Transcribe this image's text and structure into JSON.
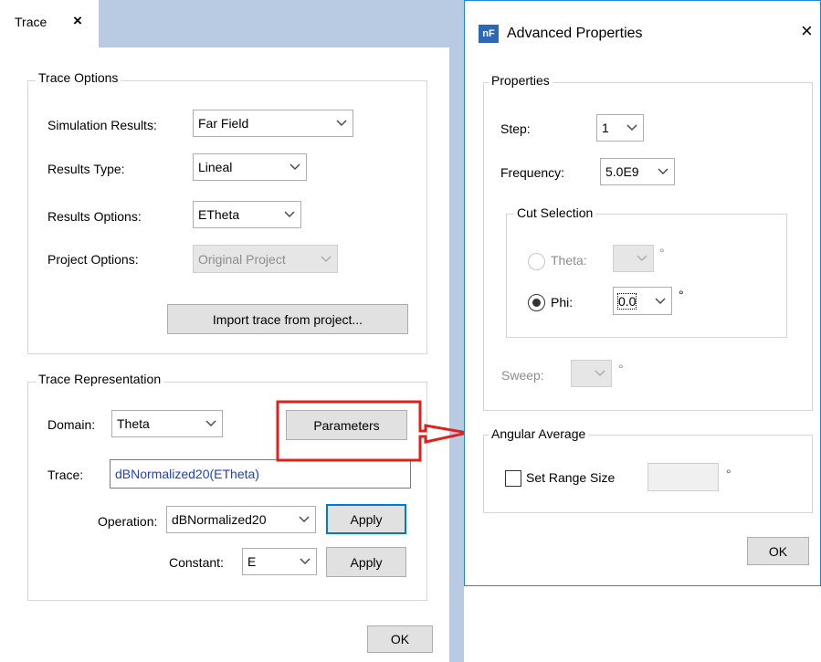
{
  "left": {
    "tab_label": "Trace",
    "tab_close": "×",
    "trace_options": {
      "legend": "Trace Options",
      "simulation_results_label": "Simulation Results:",
      "simulation_results_value": "Far Field",
      "results_type_label": "Results Type:",
      "results_type_value": "Lineal",
      "results_options_label": "Results Options:",
      "results_options_value": "ETheta",
      "project_options_label": "Project Options:",
      "project_options_value": "Original Project",
      "import_button": "Import trace from project..."
    },
    "trace_representation": {
      "legend": "Trace Representation",
      "domain_label": "Domain:",
      "domain_value": "Theta",
      "parameters_button": "Parameters",
      "trace_label": "Trace:",
      "trace_value": "dBNormalized20(ETheta)",
      "operation_label": "Operation:",
      "operation_value": "dBNormalized20",
      "operation_apply": "Apply",
      "constant_label": "Constant:",
      "constant_value": "E",
      "constant_apply": "Apply"
    },
    "ok_button": "OK"
  },
  "dialog": {
    "icon_text": "nF",
    "title": "Advanced Properties",
    "close": "×",
    "properties": {
      "legend": "Properties",
      "step_label": "Step:",
      "step_value": "1",
      "frequency_label": "Frequency:",
      "frequency_value": "5.0E9",
      "cut_selection": {
        "legend": "Cut Selection",
        "theta_label": "Theta:",
        "theta_value": "",
        "theta_unit": "°",
        "phi_label": "Phi:",
        "phi_value": "0.0",
        "phi_unit": "°"
      },
      "sweep_label": "Sweep:",
      "sweep_value": "",
      "sweep_unit": "°"
    },
    "angular_average": {
      "legend": "Angular Average",
      "set_range_label": "Set Range Size",
      "range_value": "",
      "range_unit": "°"
    },
    "ok_button": "OK"
  },
  "colors": {
    "accent": "#0078d7",
    "annotation_arrow": "#e0201f",
    "panel_strip": "#b8cbe2"
  }
}
